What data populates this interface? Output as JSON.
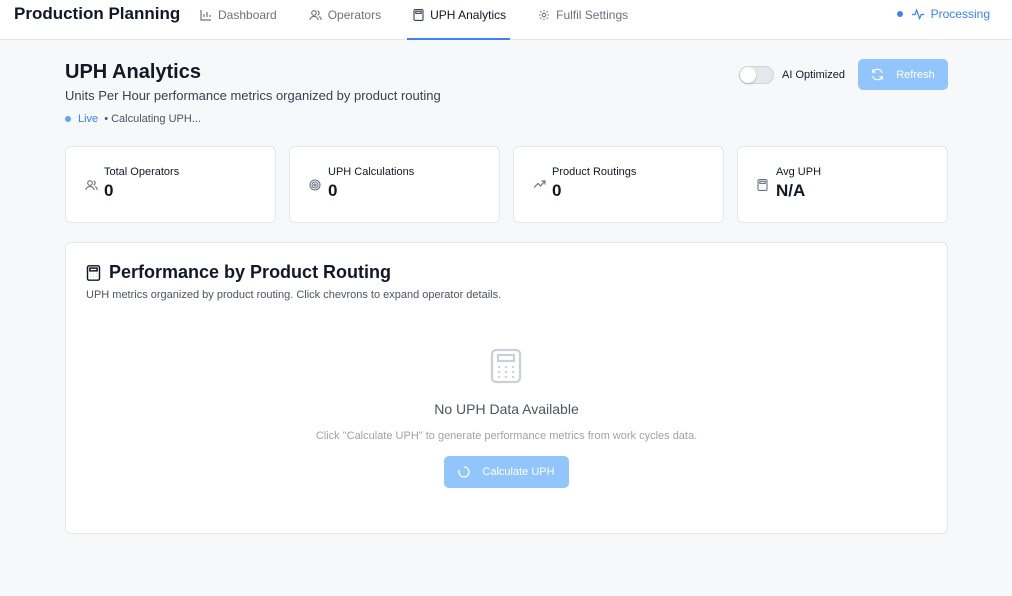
{
  "app": {
    "title": "Production Planning"
  },
  "nav": {
    "items": [
      {
        "label": "Dashboard",
        "icon": "bar-chart-icon"
      },
      {
        "label": "Operators",
        "icon": "users-icon"
      },
      {
        "label": "UPH Analytics",
        "icon": "calculator-icon",
        "active": true
      },
      {
        "label": "Fulfil Settings",
        "icon": "gear-icon"
      }
    ]
  },
  "status": {
    "label": "Processing",
    "icon": "activity-icon",
    "color": "#3b82f6"
  },
  "header": {
    "title": "UPH Analytics",
    "subtitle": "Units Per Hour performance metrics organized by product routing",
    "live_label": "Live",
    "live_status": "• Calculating UPH..."
  },
  "controls": {
    "toggle_label": "AI Optimized",
    "toggle_on": false,
    "refresh_label": "Refresh"
  },
  "stats": [
    {
      "label": "Total Operators",
      "value": "0",
      "icon": "users-icon"
    },
    {
      "label": "UPH Calculations",
      "value": "0",
      "icon": "target-icon"
    },
    {
      "label": "Product Routings",
      "value": "0",
      "icon": "trending-up-icon"
    },
    {
      "label": "Avg UPH",
      "value": "N/A",
      "icon": "calculator-icon"
    }
  ],
  "routing_panel": {
    "title": "Performance by Product Routing",
    "description": "UPH metrics organized by product routing. Click chevrons to expand operator details.",
    "empty_title": "No UPH Data Available",
    "empty_description": "Click \"Calculate UPH\" to generate performance metrics from work cycles data.",
    "button_label": "Calculate UPH"
  },
  "colors": {
    "accent": "#3b82f6",
    "button_disabled": "#93c5fd",
    "background": "#f7f8fa"
  }
}
